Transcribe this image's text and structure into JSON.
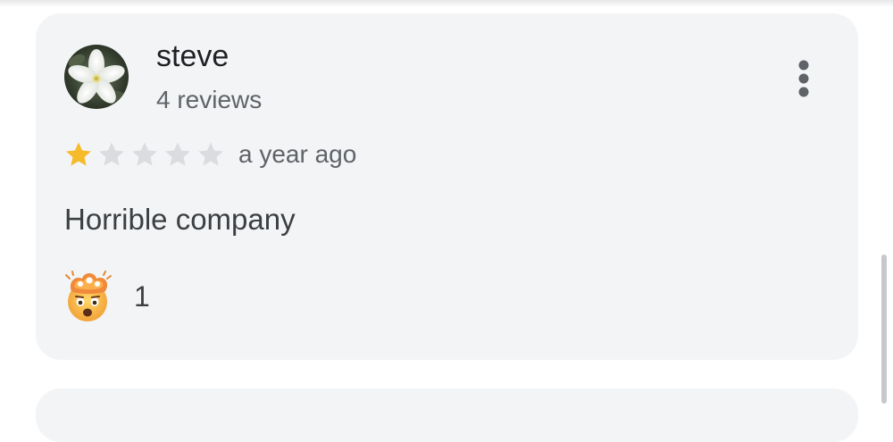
{
  "review": {
    "author_name": "steve",
    "author_review_count": "4 reviews",
    "rating": 1,
    "rating_max": 5,
    "timestamp": "a year ago",
    "text": "Horrible company",
    "reaction": {
      "icon": "exploding-head-emoji-icon",
      "count": "1"
    },
    "menu_icon": "more-vertical-icon",
    "avatar_icon": "white-flower-avatar-icon"
  },
  "colors": {
    "card_background": "#f3f4f6",
    "star_filled": "#f6bb2a",
    "star_empty": "#dadce0",
    "primary_text": "#202124",
    "secondary_text": "#5f6368"
  }
}
